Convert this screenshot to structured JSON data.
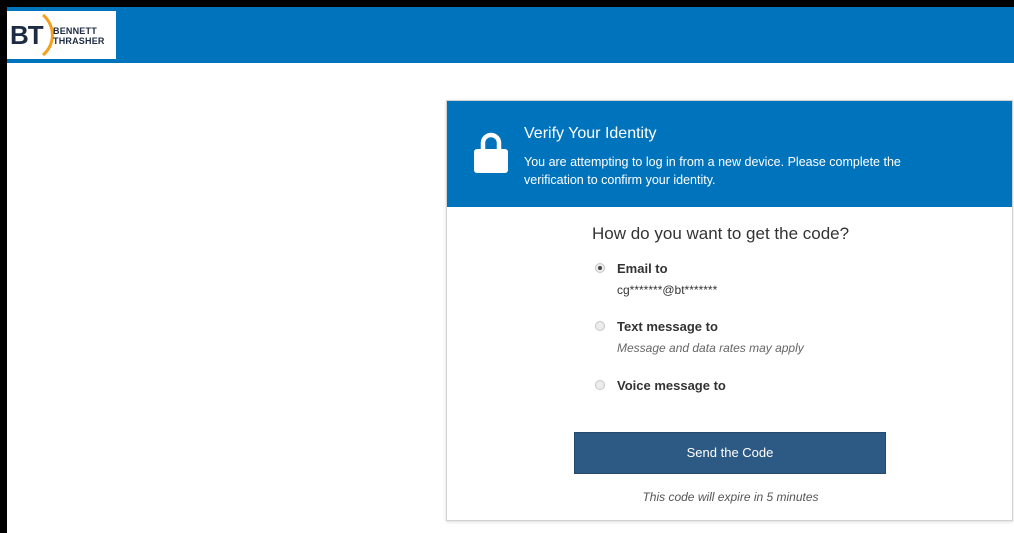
{
  "brand": {
    "logo_mark": "BT",
    "logo_name_line1": "BENNETT",
    "logo_name_line2": "THRASHER"
  },
  "colors": {
    "brand_blue": "#0073bd",
    "button_blue": "#2d5a85",
    "logo_gold": "#f4a01c"
  },
  "verify": {
    "icon": "lock-icon",
    "title": "Verify Your Identity",
    "description": "You are attempting to log in from a new device. Please complete the verification to confirm your identity.",
    "question": "How do you want to get the code?",
    "options": [
      {
        "label": "Email to",
        "detail": "cg*******@bt*******",
        "selected": true
      },
      {
        "label": "Text message to",
        "detail": "Message and data rates may apply",
        "selected": false
      },
      {
        "label": "Voice message to",
        "selected": false
      }
    ],
    "send_button_label": "Send the Code",
    "expiry_note": "This code will expire in 5 minutes"
  }
}
